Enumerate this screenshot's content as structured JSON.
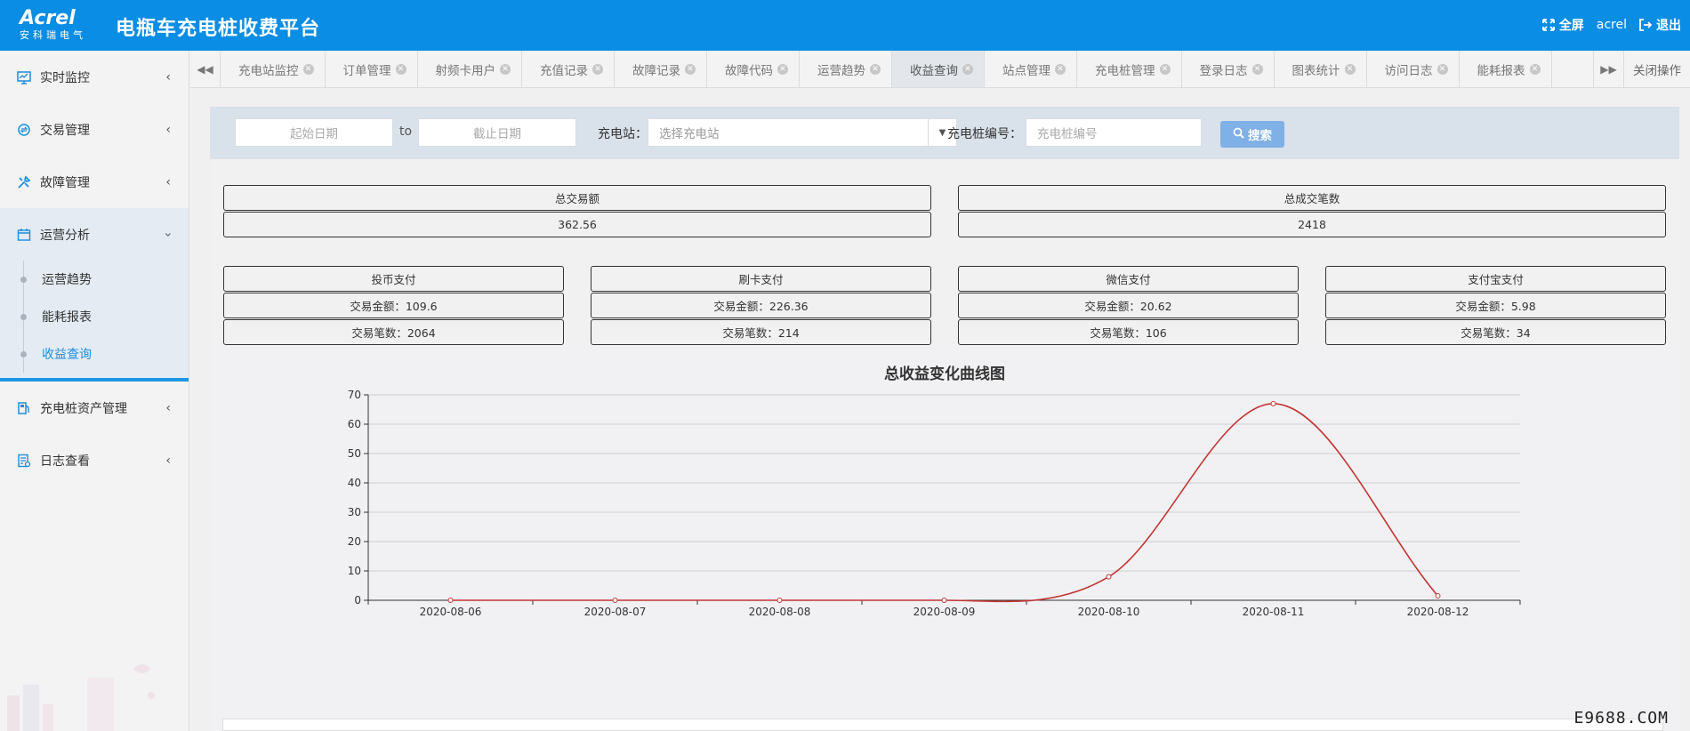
{
  "header": {
    "logo_main": "Acrel",
    "logo_sub": "安科瑞电气",
    "title": "电瓶车充电桩收费平台",
    "fullscreen": "全屏",
    "user": "acrel",
    "logout": "退出"
  },
  "sidebar": {
    "items": [
      {
        "label": "实时监控",
        "icon": "monitor-icon"
      },
      {
        "label": "交易管理",
        "icon": "exchange-icon"
      },
      {
        "label": "故障管理",
        "icon": "tools-icon"
      },
      {
        "label": "运营分析",
        "icon": "calendar-icon"
      },
      {
        "label": "充电桩资产管理",
        "icon": "fuel-pump-icon"
      },
      {
        "label": "日志查看",
        "icon": "log-icon"
      }
    ],
    "subitems": [
      "运营趋势",
      "能耗报表",
      "收益查询"
    ]
  },
  "tabs": [
    "充电站监控",
    "订单管理",
    "射频卡用户",
    "充值记录",
    "故障记录",
    "故障代码",
    "运营趋势",
    "收益查询",
    "站点管理",
    "充电桩管理",
    "登录日志",
    "图表统计",
    "访问日志",
    "能耗报表"
  ],
  "close_ops": "关闭操作",
  "search": {
    "start_placeholder": "起始日期",
    "to": "to",
    "end_placeholder": "截止日期",
    "station_label": "充电站：",
    "station_placeholder": "选择充电站",
    "pile_label": "充电桩编号：",
    "pile_placeholder": "充电桩编号",
    "button": "搜索"
  },
  "summary": {
    "total_amount_label": "总交易额",
    "total_amount": "362.56",
    "total_count_label": "总成交笔数",
    "total_count": "2418"
  },
  "payments": [
    {
      "name": "投币支付",
      "amount": "交易金额：109.6",
      "count": "交易笔数：2064"
    },
    {
      "name": "刷卡支付",
      "amount": "交易金额：226.36",
      "count": "交易笔数：214"
    },
    {
      "name": "微信支付",
      "amount": "交易金额：20.62",
      "count": "交易笔数：106"
    },
    {
      "name": "支付宝支付",
      "amount": "交易金额：5.98",
      "count": "交易笔数：34"
    }
  ],
  "chart_data": {
    "type": "line",
    "title": "总收益变化曲线图",
    "x": [
      "2020-08-06",
      "2020-08-07",
      "2020-08-08",
      "2020-08-09",
      "2020-08-10",
      "2020-08-11",
      "2020-08-12"
    ],
    "series": [
      {
        "values": [
          0,
          0,
          0,
          0,
          8,
          67,
          1.5
        ]
      }
    ],
    "ylim": [
      0,
      70
    ],
    "yticks": [
      0,
      10,
      20,
      30,
      40,
      50,
      60,
      70
    ],
    "grid": true,
    "line_color": "#c23531"
  },
  "watermark": "E9688.COM"
}
